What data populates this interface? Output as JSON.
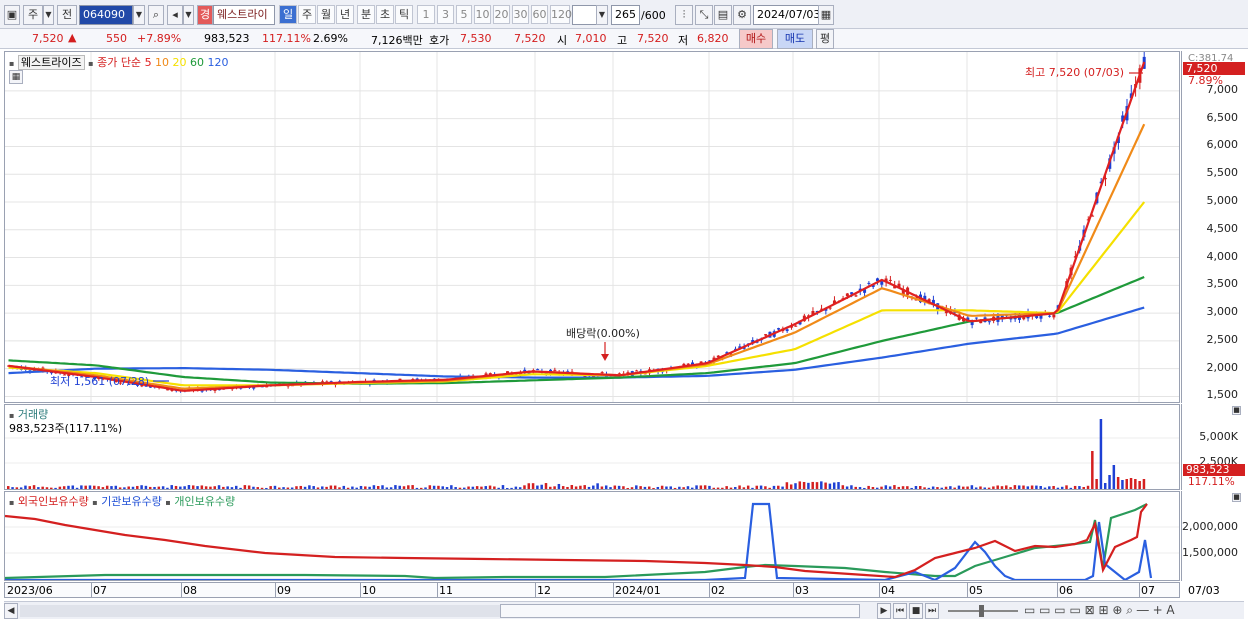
{
  "toolbar": {
    "mode1": "주",
    "mode2": "전",
    "code": "064090",
    "stock_name": "웨스트라이",
    "stock_badge": "경",
    "periods": [
      "일",
      "주",
      "월",
      "년",
      "분",
      "초",
      "틱"
    ],
    "active_period": "일",
    "intervals": [
      "1",
      "3",
      "5",
      "10",
      "20",
      "30",
      "60",
      "120"
    ],
    "count": "265",
    "count_total": "/600",
    "date": "2024/07/03"
  },
  "quote": {
    "price": "7,520",
    "arrow": "▲",
    "change": "550",
    "change_pct": "+7.89%",
    "volume": "983,523",
    "volume_ratio": "117.11%",
    "turnover": "2.69%",
    "amount": "7,126백만",
    "hoga_label": "호가",
    "ask": "7,530",
    "bid": "7,520",
    "open_label": "시",
    "open": "7,010",
    "high_label": "고",
    "high": "7,520",
    "low_label": "저",
    "low": "6,820",
    "buy_label": "매수",
    "sell_label": "매도",
    "avg_label": "평"
  },
  "price_panel": {
    "title": "웨스트라이즈",
    "ma_label": "종가 단순",
    "ma_periods": [
      "5",
      "10",
      "20",
      "60",
      "120"
    ],
    "ma_colors": [
      "#e02020",
      "#f08a18",
      "#f5e000",
      "#1f9a3a",
      "#2a5fe0"
    ],
    "c_value": "C:381.74",
    "current_price": "7,520",
    "current_pct": "7.89%",
    "high_annot": "최고 7,520 (07/03)",
    "low_annot": "최저 1,561 (07/28)",
    "dividend_annot": "배당락(0.00%)",
    "y_ticks": [
      "7,000",
      "6,500",
      "6,000",
      "5,500",
      "5,000",
      "4,500",
      "4,000",
      "3,500",
      "3,000",
      "2,500",
      "2,000",
      "1,500"
    ]
  },
  "volume_panel": {
    "title": "거래량",
    "value_line": "983,523주(117.11%)",
    "y_ticks": [
      "5,000K",
      "2,500K"
    ],
    "current_value": "983,523",
    "current_pct": "117.11%"
  },
  "holdings_panel": {
    "series": [
      "외국인보유수량",
      "기관보유수량",
      "개인보유수량"
    ],
    "series_colors": [
      "#d42020",
      "#2a5fe0",
      "#2a9a5a"
    ],
    "y_ticks": [
      "2,000,000",
      "1,500,000"
    ]
  },
  "x_axis": {
    "labels": [
      "2023/06",
      "07",
      "08",
      "09",
      "10",
      "11",
      "12",
      "2024/01",
      "02",
      "03",
      "04",
      "05",
      "06",
      "07"
    ],
    "end_label": "07/03"
  },
  "chart_data": {
    "type": "line",
    "title": "웨스트라이즈",
    "series": [
      {
        "name": "5",
        "x": [
          "2023/06",
          "2023/07",
          "2023/08",
          "2023/09",
          "2023/10",
          "2023/11",
          "2023/12",
          "2024/01",
          "2024/02",
          "2024/03",
          "2024/04",
          "2024/05",
          "2024/06",
          "2024/07"
        ],
        "values": [
          2050,
          1850,
          1600,
          1700,
          1760,
          1800,
          1950,
          1880,
          2100,
          2800,
          3600,
          2850,
          3000,
          7520
        ]
      },
      {
        "name": "10",
        "x": [
          "2023/06",
          "2023/07",
          "2023/08",
          "2023/09",
          "2023/10",
          "2023/11",
          "2023/12",
          "2024/01",
          "2024/02",
          "2024/03",
          "2024/04",
          "2024/05",
          "2024/06",
          "2024/07"
        ],
        "values": [
          2050,
          1880,
          1640,
          1700,
          1750,
          1780,
          1950,
          1880,
          2080,
          2650,
          3450,
          2950,
          3000,
          6400
        ]
      },
      {
        "name": "20",
        "x": [
          "2023/06",
          "2023/07",
          "2023/08",
          "2023/09",
          "2023/10",
          "2023/11",
          "2023/12",
          "2024/01",
          "2024/02",
          "2024/03",
          "2024/04",
          "2024/05",
          "2024/06",
          "2024/07"
        ],
        "values": [
          2020,
          1920,
          1700,
          1700,
          1740,
          1770,
          1900,
          1880,
          2050,
          2350,
          3050,
          3050,
          3000,
          5000
        ]
      },
      {
        "name": "60",
        "x": [
          "2023/06",
          "2023/07",
          "2023/08",
          "2023/09",
          "2023/10",
          "2023/11",
          "2023/12",
          "2024/01",
          "2024/02",
          "2024/03",
          "2024/04",
          "2024/05",
          "2024/06",
          "2024/07"
        ],
        "values": [
          2150,
          2060,
          1850,
          1750,
          1730,
          1740,
          1790,
          1840,
          1920,
          2100,
          2500,
          2850,
          3000,
          3650
        ]
      },
      {
        "name": "120",
        "x": [
          "2023/06",
          "2023/07",
          "2023/08",
          "2023/09",
          "2023/10",
          "2023/11",
          "2023/12",
          "2024/01",
          "2024/02",
          "2024/03",
          "2024/04",
          "2024/05",
          "2024/06",
          "2024/07"
        ],
        "values": [
          1920,
          2000,
          2010,
          1980,
          1920,
          1860,
          1840,
          1840,
          1870,
          1980,
          2200,
          2450,
          2630,
          3100
        ]
      }
    ],
    "ylim": [
      1400,
      7700
    ]
  }
}
